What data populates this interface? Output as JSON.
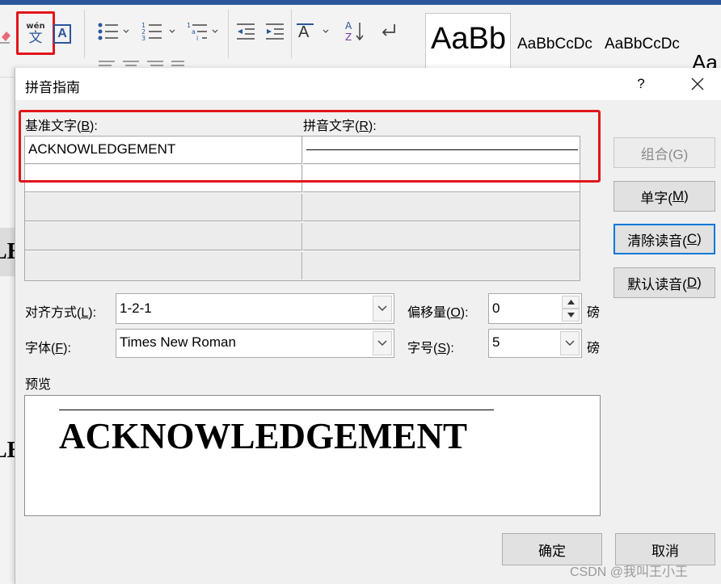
{
  "ribbon": {
    "phonetic_icon_top": "wén",
    "phonetic_icon_char": "文",
    "char_border_icon": "A",
    "sort_icon_top": "A",
    "sort_icon_bottom": "Z",
    "styles": [
      {
        "preview": "AaBb"
      },
      {
        "preview": "AaBbCcDc"
      },
      {
        "preview": "AaBbCcDc"
      },
      {
        "preview": "Aa"
      }
    ]
  },
  "page": {
    "fragment_1": "LE",
    "fragment_2": "LE"
  },
  "dialog": {
    "title": "拼音指南",
    "help": "?",
    "base_text_label": "基准文字(",
    "base_text_key": "B",
    "base_text_tail": "):",
    "ruby_text_label": "拼音文字(",
    "ruby_text_key": "R",
    "ruby_text_tail": "):",
    "rows": [
      {
        "base": "ACKNOWLEDGEMENT",
        "ruby": ""
      },
      {
        "base": "",
        "ruby": ""
      },
      {
        "base": "",
        "ruby": ""
      },
      {
        "base": "",
        "ruby": ""
      },
      {
        "base": "",
        "ruby": ""
      }
    ],
    "buttons": {
      "group": "组合(G)",
      "mono_pre": "单字(",
      "mono_key": "M",
      "mono_tail": ")",
      "clear_pre": "清除读音(",
      "clear_key": "C",
      "clear_tail": ")",
      "default_pre": "默认读音(",
      "default_key": "D",
      "default_tail": ")",
      "ok": "确定",
      "cancel": "取消"
    },
    "alignment": {
      "label_pre": "对齐方式(",
      "key": "L",
      "label_tail": "):",
      "value": "1-2-1"
    },
    "offset": {
      "label_pre": "偏移量(",
      "key": "O",
      "label_tail": "):",
      "value": "0",
      "unit": "磅"
    },
    "font": {
      "label_pre": "字体(",
      "key": "F",
      "label_tail": "):",
      "value": "Times New Roman"
    },
    "size": {
      "label_pre": "字号(",
      "key": "S",
      "label_tail": "):",
      "value": "5",
      "unit": "磅"
    },
    "preview": {
      "label": "预览",
      "text": "ACKNOWLEDGEMENT"
    }
  },
  "watermark": "CSDN @我叫王小王",
  "colors": {
    "highlight_red": "#e0161b",
    "focus_blue": "#0078d7",
    "word_blue": "#2b579a"
  }
}
